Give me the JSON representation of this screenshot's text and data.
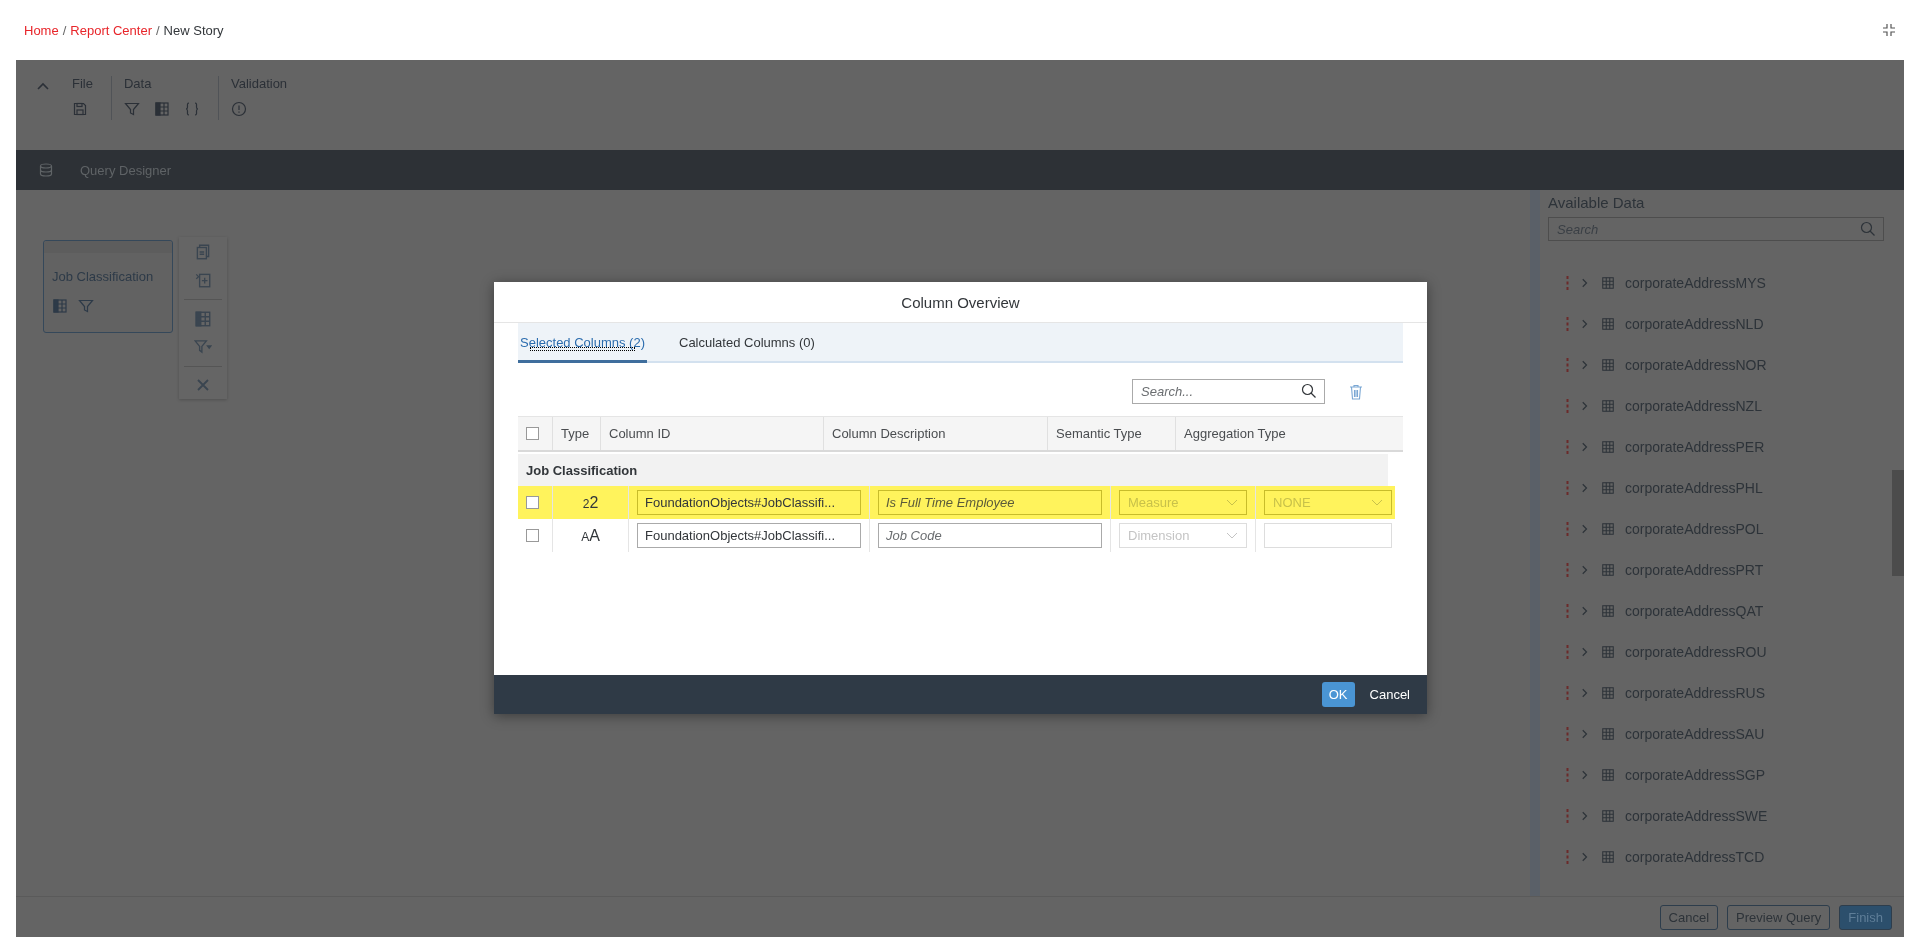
{
  "breadcrumb": [
    {
      "label": "Home",
      "kind": "link"
    },
    {
      "label": "/",
      "kind": "separator"
    },
    {
      "label": "Report Center",
      "kind": "link"
    },
    {
      "label": "/",
      "kind": "separator"
    },
    {
      "label": "New Story",
      "kind": "current"
    }
  ],
  "toolbar": {
    "groups": [
      {
        "label": "File",
        "tools": [
          {
            "kind": "save"
          }
        ]
      },
      {
        "label": "Data",
        "tools": [
          {
            "kind": "filter"
          },
          {
            "kind": "table"
          },
          {
            "kind": "braces"
          }
        ]
      },
      {
        "label": "Validation",
        "tools": [
          {
            "kind": "alert"
          }
        ]
      }
    ]
  },
  "query_designer": {
    "title": "Query Designer"
  },
  "canvas": {
    "node": {
      "title": "Job Classification",
      "selected": true
    }
  },
  "available_data": {
    "title": "Available Data",
    "search": {
      "placeholder": "Search"
    },
    "items": [
      "corporateAddressMYS",
      "corporateAddressNLD",
      "corporateAddressNOR",
      "corporateAddressNZL",
      "corporateAddressPER",
      "corporateAddressPHL",
      "corporateAddressPOL",
      "corporateAddressPRT",
      "corporateAddressQAT",
      "corporateAddressROU",
      "corporateAddressRUS",
      "corporateAddressSAU",
      "corporateAddressSGP",
      "corporateAddressSWE",
      "corporateAddressTCD"
    ]
  },
  "footer_buttons": [
    {
      "label": "Cancel",
      "kind": "secondary"
    },
    {
      "label": "Preview Query",
      "kind": "secondary"
    },
    {
      "label": "Finish",
      "kind": "primary"
    }
  ],
  "dialog": {
    "title": "Column Overview",
    "tabs": [
      {
        "label": "Selected Columns (2)",
        "selected": true
      },
      {
        "label": "Calculated Columns (0)",
        "selected": false
      }
    ],
    "search": {
      "placeholder": "Search..."
    },
    "table": {
      "columns": [
        "Type",
        "Column ID",
        "Column Description",
        "Semantic Type",
        "Aggregation Type"
      ],
      "header_checked": false,
      "group": "Job Classification",
      "rows": [
        {
          "checked": false,
          "highlighted": true,
          "type_glyph": "22",
          "column_id": "FoundationObjects#JobClassifi...",
          "description_placeholder": "Is Full Time Employee",
          "semantic_type": "Measure",
          "aggregation_type": "NONE"
        },
        {
          "checked": false,
          "highlighted": false,
          "type_glyph": "AA",
          "column_id": "FoundationObjects#JobClassifi...",
          "description_placeholder": "Job Code",
          "semantic_type": "Dimension"
        }
      ]
    },
    "buttons": [
      {
        "label": "OK",
        "kind": "primary"
      },
      {
        "label": "Cancel",
        "kind": "secondary"
      }
    ]
  }
}
